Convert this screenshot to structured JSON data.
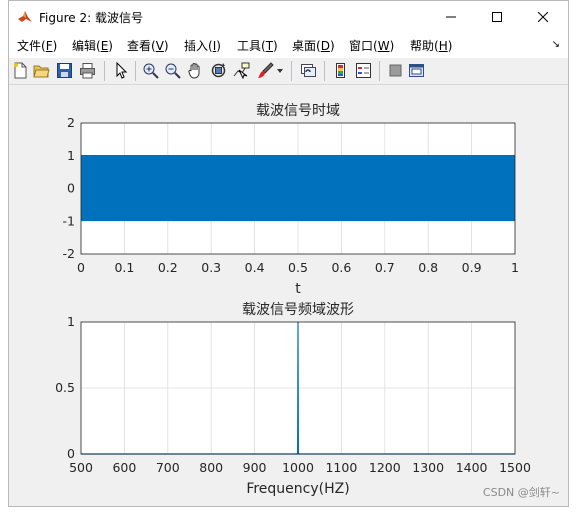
{
  "window": {
    "title": "Figure 2: 载波信号"
  },
  "menu": {
    "items": [
      {
        "label": "文件(",
        "key": "F",
        "close": ")"
      },
      {
        "label": "编辑(",
        "key": "E",
        "close": ")"
      },
      {
        "label": "查看(",
        "key": "V",
        "close": ")"
      },
      {
        "label": "插入(",
        "key": "I",
        "close": ")"
      },
      {
        "label": "工具(",
        "key": "T",
        "close": ")"
      },
      {
        "label": "桌面(",
        "key": "D",
        "close": ")"
      },
      {
        "label": "窗口(",
        "key": "W",
        "close": ")"
      },
      {
        "label": "帮助(",
        "key": "H",
        "close": ")"
      }
    ],
    "corner_glyph": "↘"
  },
  "toolbar": {
    "icons": [
      "new-figure-icon",
      "open-file-icon",
      "save-icon",
      "print-icon",
      "pointer-icon",
      "zoom-in-icon",
      "zoom-out-icon",
      "pan-hand-icon",
      "rotate-3d-icon",
      "data-cursor-icon",
      "brush-icon",
      "brush-dropdown-icon",
      "link-plot-icon",
      "colorbar-icon",
      "legend-icon",
      "hide-plot-tools-icon",
      "show-plot-tools-icon"
    ]
  },
  "chart_data": [
    {
      "type": "line",
      "title": "载波信号时域",
      "xlabel": "t",
      "ylabel": "",
      "xlim": [
        0,
        1
      ],
      "ylim": [
        -2,
        2
      ],
      "xticks": [
        "0",
        "0.1",
        "0.2",
        "0.3",
        "0.4",
        "0.5",
        "0.6",
        "0.7",
        "0.8",
        "0.9",
        "1"
      ],
      "yticks": [
        "2",
        "1",
        "0",
        "-1",
        "-2"
      ],
      "series": [
        {
          "description_only": false,
          "kind": "carrier",
          "frequency_hz": 1000,
          "amplitude": 1,
          "values_min": -1,
          "values_max": 1
        }
      ],
      "grid": true,
      "color": "#0072bd"
    },
    {
      "type": "line",
      "title": "载波信号频域波形",
      "xlabel": "Frequency(HZ)",
      "ylabel": "",
      "xlim": [
        500,
        1500
      ],
      "ylim": [
        0,
        1
      ],
      "xticks": [
        "500",
        "600",
        "700",
        "800",
        "900",
        "1000",
        "1100",
        "1200",
        "1300",
        "1400",
        "1500"
      ],
      "yticks": [
        "1",
        "0.5",
        "0"
      ],
      "series": [
        {
          "x": [
            500,
            998,
            999,
            1000,
            1001,
            1002,
            1500
          ],
          "y": [
            0,
            0,
            0.01,
            1,
            0.01,
            0,
            0
          ]
        }
      ],
      "grid": true,
      "color": "#0072bd"
    }
  ],
  "watermark": "CSDN @剑轩~"
}
